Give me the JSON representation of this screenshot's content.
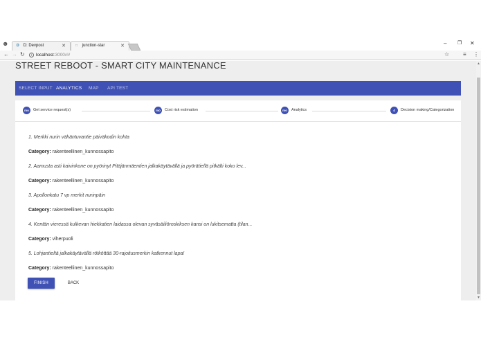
{
  "browser": {
    "tabs": [
      {
        "favicon": "D",
        "label": "D: Devpost"
      },
      {
        "favicon": "page-icon",
        "label": "junction-star"
      }
    ],
    "url_host": "localhost",
    "url_path": ":3000/#/"
  },
  "page": {
    "title": "STREET REBOOT - SMART CITY MAINTENANCE"
  },
  "nav": {
    "tabs": [
      {
        "label": "SELECT INPUT"
      },
      {
        "label": "ANALYTICS"
      },
      {
        "label": "MAP"
      },
      {
        "label": "API TEST"
      }
    ],
    "active": "ANALYTICS"
  },
  "stepper": {
    "steps": [
      {
        "badge": "mo",
        "label": "Get service request(s)"
      },
      {
        "badge": "mo",
        "label": "Cost risk estimation"
      },
      {
        "badge": "mo",
        "label": "Analytics"
      },
      {
        "badge": "4",
        "label": "Decision making/Categorization"
      }
    ]
  },
  "results": {
    "category_label": "Category:",
    "items": [
      {
        "title": "1. Merkki nurin vähäntuvantie päiväkodin kohta",
        "category": "rakenteellinen_kunnossapito"
      },
      {
        "title": "2. Aamusta asti kaivinkone on pyörinyt Pitäjänmäentien jalkakäytävällä ja pyörätiellä pitkälti koko lev...",
        "category": "rakenteellinen_kunnossapito"
      },
      {
        "title": "3. Apollonkatu 7 vp merkit nurinpäin",
        "category": "rakenteellinen_kunnossapito"
      },
      {
        "title": "4. Kentän vieressä kulkevan hiekkatien laidassa olevan syväsäiliöroskiksen kansi on lukitsematta (tilan...",
        "category": "viherpuoli"
      },
      {
        "title": "5. Lohjantieltä jalkakäytävällä rötköttää 30-rajoitusmerkin katkennut lapa!",
        "category": "rakenteellinen_kunnossapito"
      }
    ]
  },
  "actions": {
    "finish": "FINISH",
    "back": "BACK"
  },
  "colors": {
    "primary": "#3f51b5",
    "background": "#eeeeee"
  }
}
